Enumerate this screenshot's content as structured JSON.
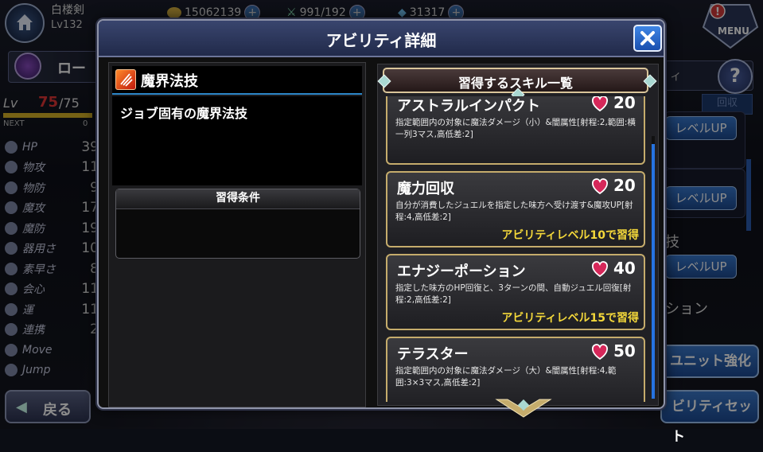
{
  "player": {
    "name": "白楼剣",
    "level": "Lv132"
  },
  "resources": {
    "gold": "15062139",
    "stamina": "991/192",
    "gems": "31317"
  },
  "menu": {
    "label": "MENU"
  },
  "unit": {
    "name": "ロー",
    "lv_label": "Lv",
    "lv_current": "75",
    "lv_max": "/75",
    "lv_progress": 1.0,
    "next_label": "NEXT",
    "next_value": "0"
  },
  "stats": [
    {
      "name": "HP",
      "value": "39"
    },
    {
      "name": "物攻",
      "value": "11"
    },
    {
      "name": "物防",
      "value": "9"
    },
    {
      "name": "魔攻",
      "value": "17"
    },
    {
      "name": "魔防",
      "value": "19"
    },
    {
      "name": "器用さ",
      "value": "10"
    },
    {
      "name": "素早さ",
      "value": "8"
    },
    {
      "name": "会心",
      "value": "11"
    },
    {
      "name": "運",
      "value": "11"
    },
    {
      "name": "連携",
      "value": "2"
    },
    {
      "name": "Move",
      "value": ""
    },
    {
      "name": "Jump",
      "value": ""
    }
  ],
  "back_button": "戻る",
  "right_panel": {
    "tab_fragment": "ィ",
    "ghost_button": "回収",
    "levelup_label": "レベルUP",
    "side_text_1": "技",
    "side_text_2": "ション",
    "unit_enhance": "ユニット強化",
    "ability_set": "ビリティセット"
  },
  "dialog": {
    "title": "アビリティ詳細",
    "ability_name": "魔界法技",
    "ability_description": "ジョブ固有の魔界法技",
    "condition_title": "習得条件",
    "skill_list_title": "習得するスキル一覧",
    "skills": [
      {
        "name": "アストラルインパクト",
        "cost": "20",
        "desc": "指定範囲内の対象に魔法ダメージ（小）&闇属性[射程:2,範囲:横一列3マス,高低差:2]",
        "req": ""
      },
      {
        "name": "魔力回収",
        "cost": "20",
        "desc": "自分が消費したジュエルを指定した味方へ受け渡す&魔攻UP[射程:4,高低差:2]",
        "req": "アビリティレベル10で習得"
      },
      {
        "name": "エナジーポーション",
        "cost": "40",
        "desc": "指定した味方のHP回復と、3ターンの間、自動ジュエル回復[射程:2,高低差:2]",
        "req": "アビリティレベル15で習得"
      },
      {
        "name": "テラスター",
        "cost": "50",
        "desc": "指定範囲内の対象に魔法ダメージ（大）&闇属性[射程:4,範囲:3×3マス,高低差:2]",
        "req": ""
      }
    ]
  },
  "colors": {
    "accent_blue": "#2673e0",
    "requirement_yellow": "#f4d83a",
    "level_red": "#e23535",
    "card_border_gold": "#c5ac6c"
  }
}
